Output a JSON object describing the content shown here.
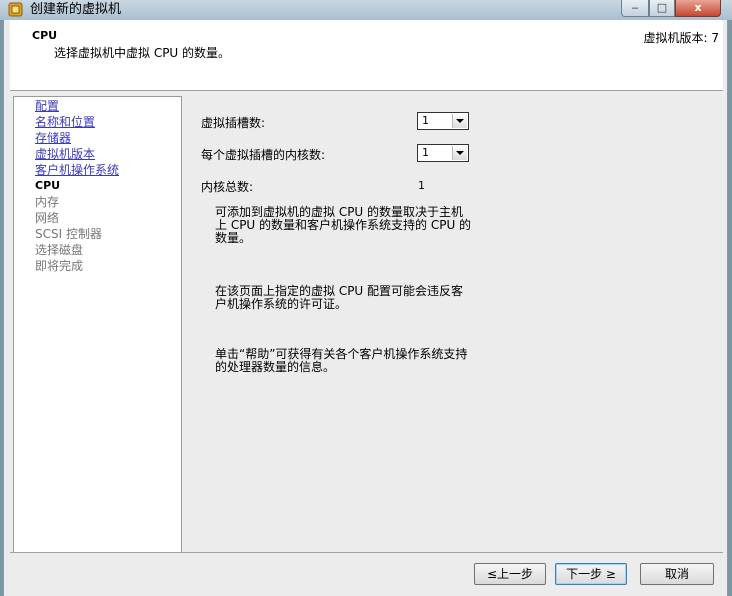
{
  "window": {
    "title": "创建新的虚拟机",
    "minimize_glyph": "‒",
    "maximize_glyph": "□",
    "close_glyph": "x"
  },
  "header": {
    "title": "CPU",
    "subtitle": "选择虚拟机中虚拟 CPU 的数量。",
    "version": "虚拟机版本: 7"
  },
  "sidebar": {
    "items": [
      {
        "label": "配置",
        "state": "completed"
      },
      {
        "label": "名称和位置",
        "state": "completed"
      },
      {
        "label": "存储器",
        "state": "completed"
      },
      {
        "label": "虚拟机版本",
        "state": "completed"
      },
      {
        "label": "客户机操作系统",
        "state": "completed"
      },
      {
        "label": "CPU",
        "state": "current"
      },
      {
        "label": "内存",
        "state": "future"
      },
      {
        "label": "网络",
        "state": "future"
      },
      {
        "label": "SCSI 控制器",
        "state": "future"
      },
      {
        "label": "选择磁盘",
        "state": "future"
      },
      {
        "label": "即将完成",
        "state": "future"
      }
    ]
  },
  "form": {
    "sockets_label": "虚拟插槽数:",
    "sockets_value": "1",
    "cores_label": "每个虚拟插槽的内核数:",
    "cores_value": "1",
    "total_label": "内核总数:",
    "total_value": "1"
  },
  "info": {
    "p1": "可添加到虚拟机的虚拟 CPU 的数量取决于主机上 CPU 的数量和客户机操作系统支持的 CPU 的数量。",
    "p2": "在该页面上指定的虚拟 CPU 配置可能会违反客户机操作系统的许可证。",
    "p3": "单击“帮助”可获得有关各个客户机操作系统支持的处理器数量的信息。"
  },
  "buttons": {
    "back": "≤上一步",
    "next": "下一步 ≥",
    "cancel": "取消"
  }
}
